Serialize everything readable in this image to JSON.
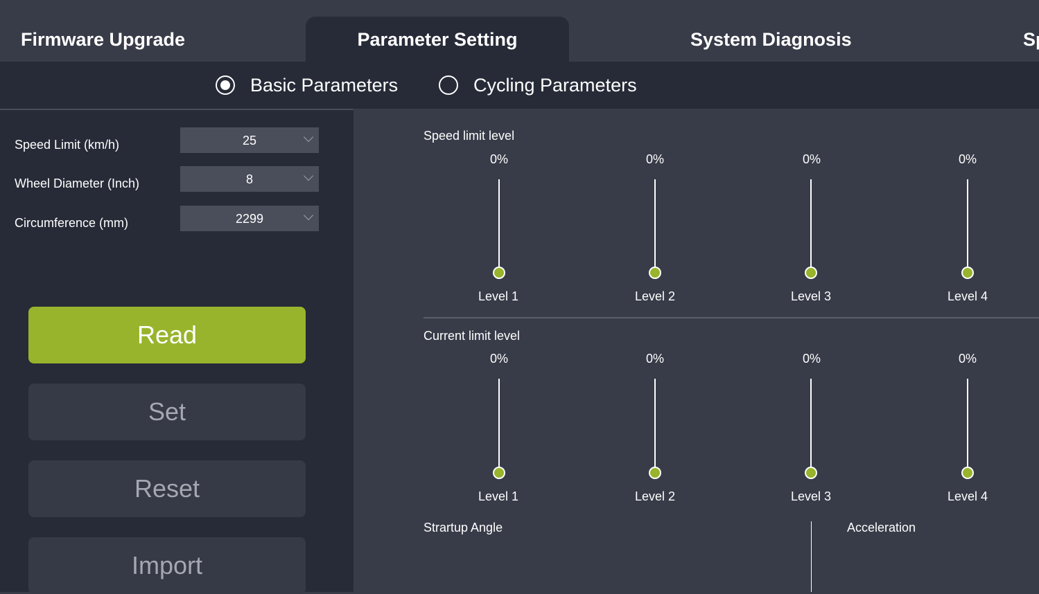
{
  "tabs": [
    {
      "label": "Firmware Upgrade"
    },
    {
      "label": "Parameter Setting"
    },
    {
      "label": "System Diagnosis"
    },
    {
      "label": "Sp"
    }
  ],
  "param_modes": [
    {
      "label": "Basic Parameters",
      "selected": true
    },
    {
      "label": "Cycling Parameters",
      "selected": false
    }
  ],
  "basic": {
    "fields": [
      {
        "label": "Speed Limit (km/h)",
        "value": "25"
      },
      {
        "label": "Wheel Diameter (Inch)",
        "value": "8"
      },
      {
        "label": "Circumference (mm)",
        "value": "2299"
      }
    ]
  },
  "actions": {
    "read": "Read",
    "set": "Set",
    "reset": "Reset",
    "import": "Import"
  },
  "speed_limit": {
    "title": "Speed limit level",
    "levels": [
      {
        "label": "Level 1",
        "value": "0%"
      },
      {
        "label": "Level 2",
        "value": "0%"
      },
      {
        "label": "Level 3",
        "value": "0%"
      },
      {
        "label": "Level 4",
        "value": "0%"
      }
    ]
  },
  "current_limit": {
    "title": "Current limit level",
    "levels": [
      {
        "label": "Level 1",
        "value": "0%"
      },
      {
        "label": "Level 2",
        "value": "0%"
      },
      {
        "label": "Level 3",
        "value": "0%"
      },
      {
        "label": "Level 4",
        "value": "0%"
      }
    ]
  },
  "startup_angle": {
    "title": "Strartup Angle"
  },
  "acceleration": {
    "title": "Acceleration"
  },
  "colors": {
    "accent": "#98b42c",
    "panel_dark": "#272a37",
    "panel_light": "#383b48"
  }
}
